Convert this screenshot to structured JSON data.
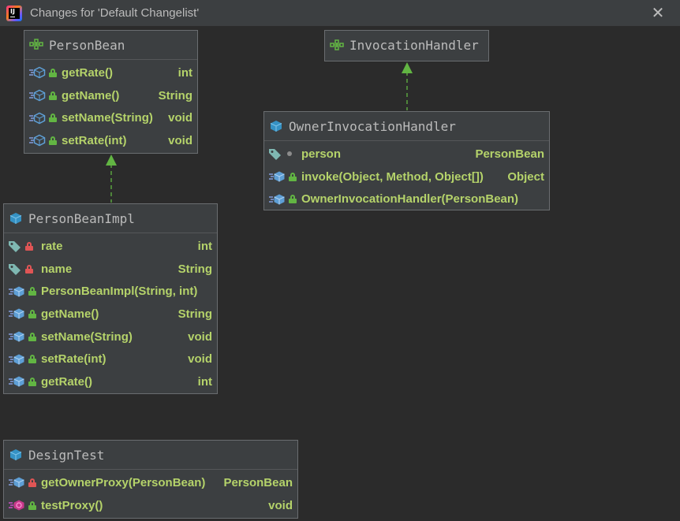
{
  "window": {
    "title": "Changes for 'Default Changelist'",
    "close_glyph": "✕",
    "logo_letters": "IJ"
  },
  "colors": {
    "background": "#2b2b2b",
    "node_fill": "#3c3f41",
    "node_border": "#6a6d70",
    "member_text": "#b5d36a",
    "edge": "#62b543",
    "class_icon": "#3592c4",
    "interface_icon": "#62b543",
    "lock_private": "#e05555",
    "lock_public": "#62b543"
  },
  "nodes": {
    "person_bean": {
      "name": "PersonBean",
      "kind": "interface",
      "members": [
        {
          "name": "getRate()",
          "type": "int",
          "icon": "abstract-method-icon",
          "access": "public"
        },
        {
          "name": "getName()",
          "type": "String",
          "icon": "abstract-method-icon",
          "access": "public"
        },
        {
          "name": "setName(String)",
          "type": "void",
          "icon": "abstract-method-icon",
          "access": "public"
        },
        {
          "name": "setRate(int)",
          "type": "void",
          "icon": "abstract-method-icon",
          "access": "public"
        }
      ]
    },
    "invocation_handler": {
      "name": "InvocationHandler",
      "kind": "interface",
      "members": []
    },
    "owner_invocation_handler": {
      "name": "OwnerInvocationHandler",
      "kind": "class",
      "members": [
        {
          "name": "person",
          "type": "PersonBean",
          "icon": "field-icon",
          "access": "package"
        },
        {
          "name": "invoke(Object, Method, Object[])",
          "type": "Object",
          "icon": "method-icon",
          "access": "public"
        },
        {
          "name": "OwnerInvocationHandler(PersonBean)",
          "type": "",
          "icon": "method-icon",
          "access": "public"
        }
      ]
    },
    "person_bean_impl": {
      "name": "PersonBeanImpl",
      "kind": "class",
      "members": [
        {
          "name": "rate",
          "type": "int",
          "icon": "field-icon",
          "access": "private"
        },
        {
          "name": "name",
          "type": "String",
          "icon": "field-icon",
          "access": "private"
        },
        {
          "name": "PersonBeanImpl(String, int)",
          "type": "",
          "icon": "method-icon",
          "access": "public"
        },
        {
          "name": "getName()",
          "type": "String",
          "icon": "method-icon",
          "access": "public"
        },
        {
          "name": "setName(String)",
          "type": "void",
          "icon": "method-icon",
          "access": "public"
        },
        {
          "name": "setRate(int)",
          "type": "void",
          "icon": "method-icon",
          "access": "public"
        },
        {
          "name": "getRate()",
          "type": "int",
          "icon": "method-icon",
          "access": "public"
        }
      ]
    },
    "design_test": {
      "name": "DesignTest",
      "kind": "class",
      "members": [
        {
          "name": "getOwnerProxy(PersonBean)",
          "type": "PersonBean",
          "icon": "method-icon",
          "access": "private"
        },
        {
          "name": "testProxy()",
          "type": "void",
          "icon": "test-method-icon",
          "access": "public"
        }
      ]
    }
  },
  "edges": [
    {
      "from": "person_bean_impl",
      "to": "person_bean",
      "style": "dashed",
      "arrow": "implements"
    },
    {
      "from": "owner_invocation_handler",
      "to": "invocation_handler",
      "style": "dashed",
      "arrow": "implements"
    }
  ]
}
